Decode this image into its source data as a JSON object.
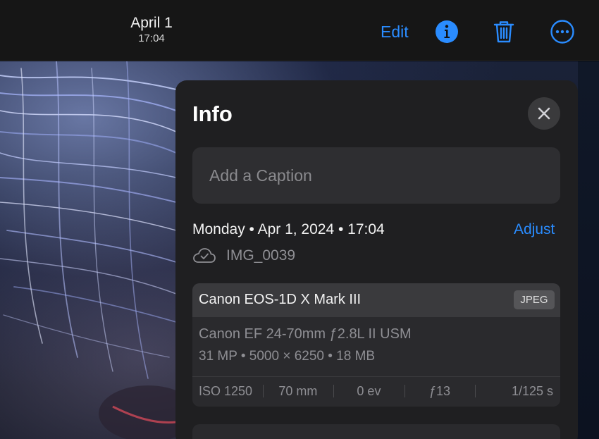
{
  "header": {
    "date": "April 1",
    "time": "17:04",
    "edit_label": "Edit"
  },
  "info_panel": {
    "title": "Info",
    "caption_placeholder": "Add a Caption",
    "datetime": "Monday • Apr 1, 2024 • 17:04",
    "adjust_label": "Adjust",
    "file_name": "IMG_0039",
    "camera": {
      "model": "Canon EOS-1D X Mark III",
      "format": "JPEG",
      "lens": "Canon EF 24-70mm ƒ2.8L II USM",
      "specs": "31 MP  •  5000 × 6250  •  18 MB",
      "exif": [
        "ISO 1250",
        "70 mm",
        "0 ev",
        "ƒ13",
        "1/125 s"
      ]
    }
  },
  "colors": {
    "accent": "#2a8cff",
    "panel_bg": "#1f1f21",
    "secondary_text": "#8e8e93"
  },
  "icons": {
    "info": "info-icon",
    "trash": "trash-icon",
    "more": "more-icon",
    "close": "close-icon",
    "icloud": "cloud-check-icon"
  }
}
